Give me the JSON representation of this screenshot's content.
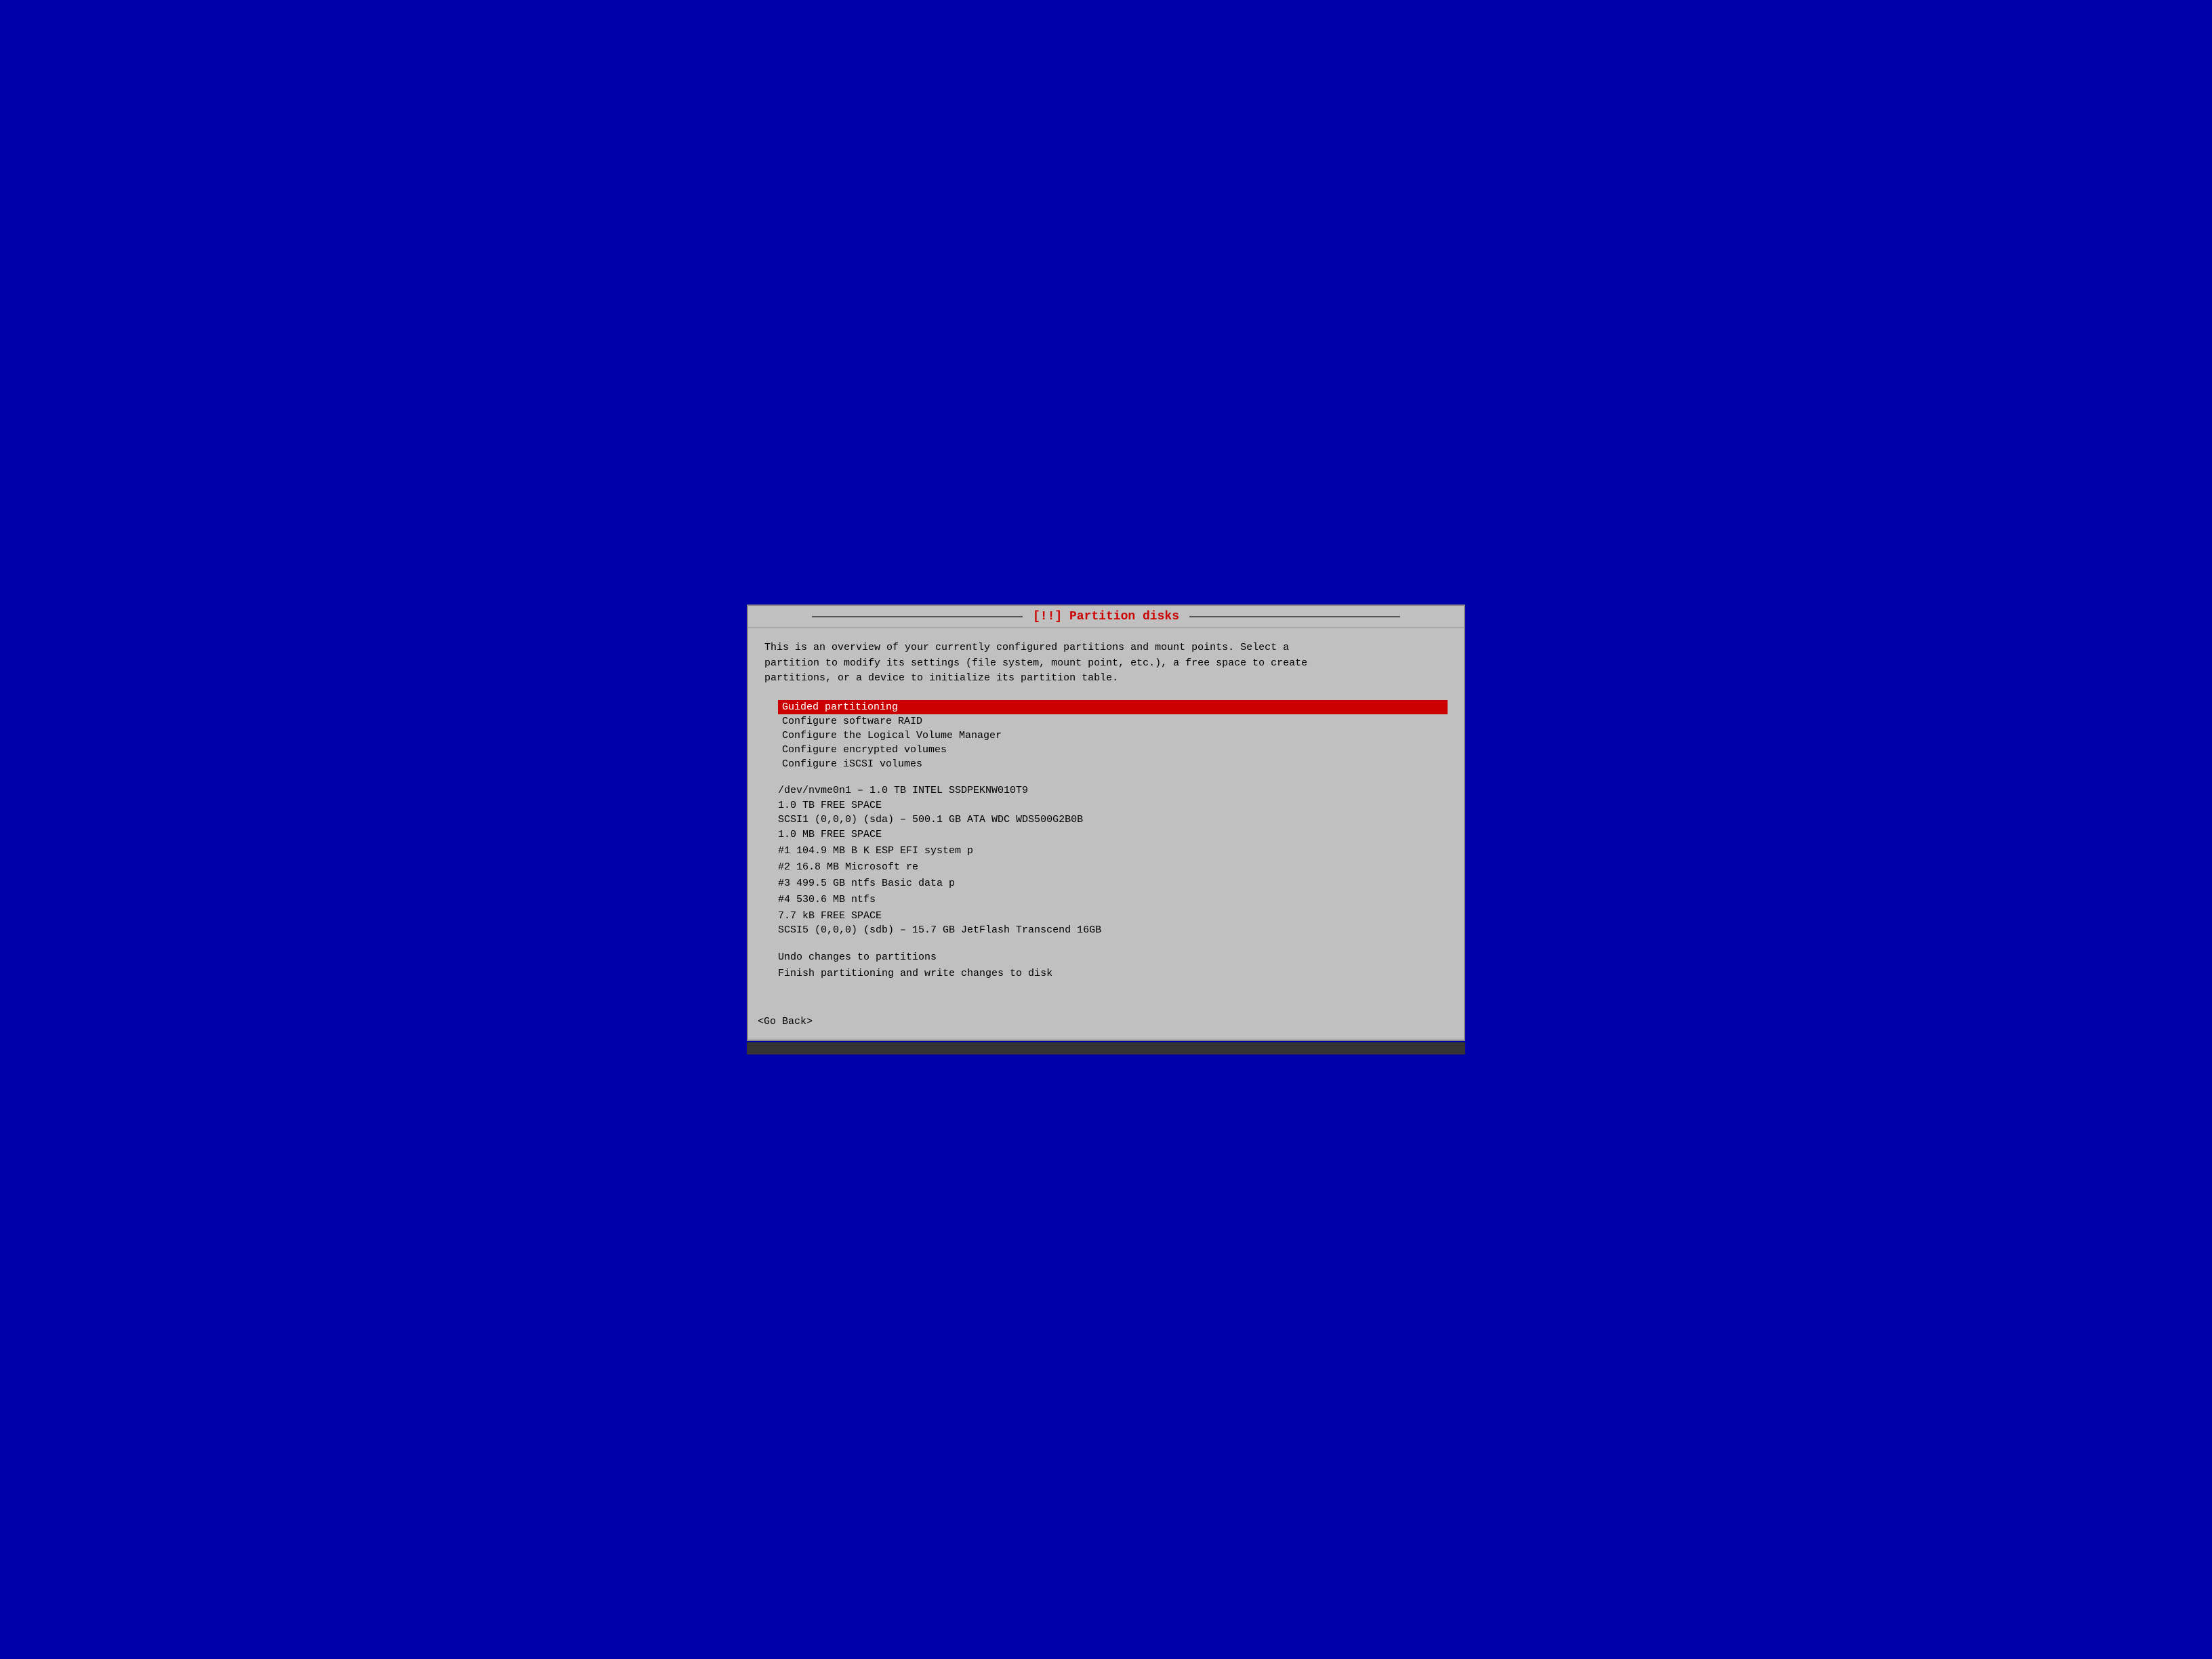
{
  "title": "[!!] Partition disks",
  "description": "This is an overview of your currently configured partitions and mount points. Select a\npartition to modify its settings (file system, mount point, etc.), a free space to create\npartitions, or a device to initialize its partition table.",
  "menu": {
    "items": [
      {
        "label": "Guided partitioning",
        "selected": true
      },
      {
        "label": "Configure software RAID",
        "selected": false
      },
      {
        "label": "Configure the Logical Volume Manager",
        "selected": false
      },
      {
        "label": "Configure encrypted volumes",
        "selected": false
      },
      {
        "label": "Configure iSCSI volumes",
        "selected": false
      }
    ]
  },
  "disks": [
    {
      "header": "/dev/nvme0n1 – 1.0 TB INTEL SSDPEKNW010T9",
      "rows": [
        "          1.0 TB         FREE SPACE"
      ]
    },
    {
      "header": "SCSI1 (0,0,0) (sda) – 500.1 GB ATA WDC WDS500G2B0B",
      "rows": [
        "          1.0 MB         FREE SPACE",
        "  #1    104.9 MB  B  K  ESP          EFI system p",
        "  #2     16.8 MB              Microsoft re",
        "  #3    499.5 GB         ntfs         Basic data p",
        "  #4    530.6 MB         ntfs",
        "          7.7 kB         FREE SPACE"
      ]
    },
    {
      "header": "SCSI5 (0,0,0) (sdb) – 15.7 GB JetFlash Transcend 16GB",
      "rows": []
    }
  ],
  "actions": [
    "Undo changes to partitions",
    "Finish partitioning and write changes to disk"
  ],
  "go_back": "<Go Back>"
}
